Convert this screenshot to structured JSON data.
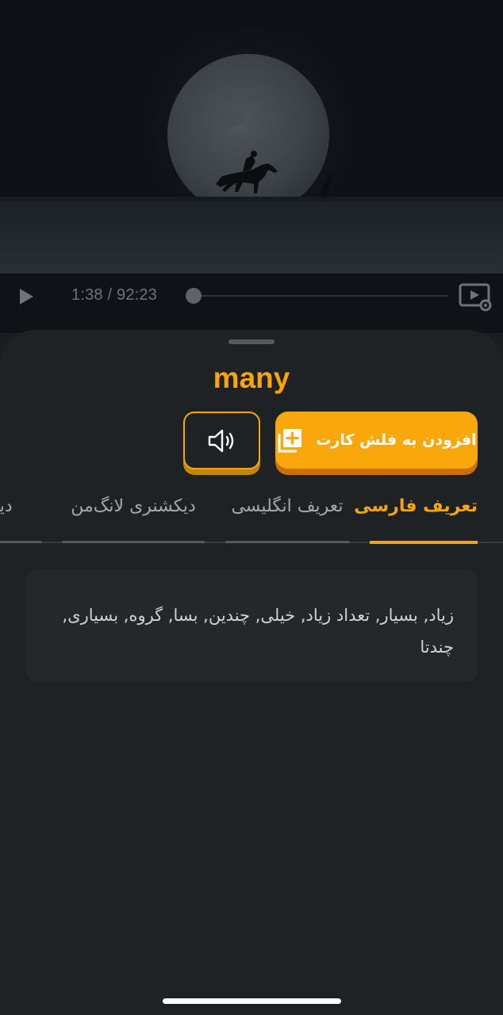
{
  "video": {
    "time": "1:38 / 92:23",
    "progress_fraction": 0.018
  },
  "word": "many",
  "actions": {
    "add_flashcard_label": "افزودن به فلش کارت",
    "sound_icon": "speaker-icon",
    "add_icon": "add-cards-icon"
  },
  "tabs": [
    {
      "label": "تعریف فارسی",
      "active": true
    },
    {
      "label": "تعریف انگلیسی",
      "active": false
    },
    {
      "label": "دیکشنری لانگ‌من",
      "active": false
    },
    {
      "label": "دیکشنری",
      "active": false
    }
  ],
  "definition": {
    "text": "زیاد, بسیار, تعداد زیاد, خیلی, چندین, بسا, گروه, بسیاری, چندتا"
  },
  "colors": {
    "accent": "#f7a50b",
    "background": "#1e2224",
    "card": "#24282a"
  }
}
